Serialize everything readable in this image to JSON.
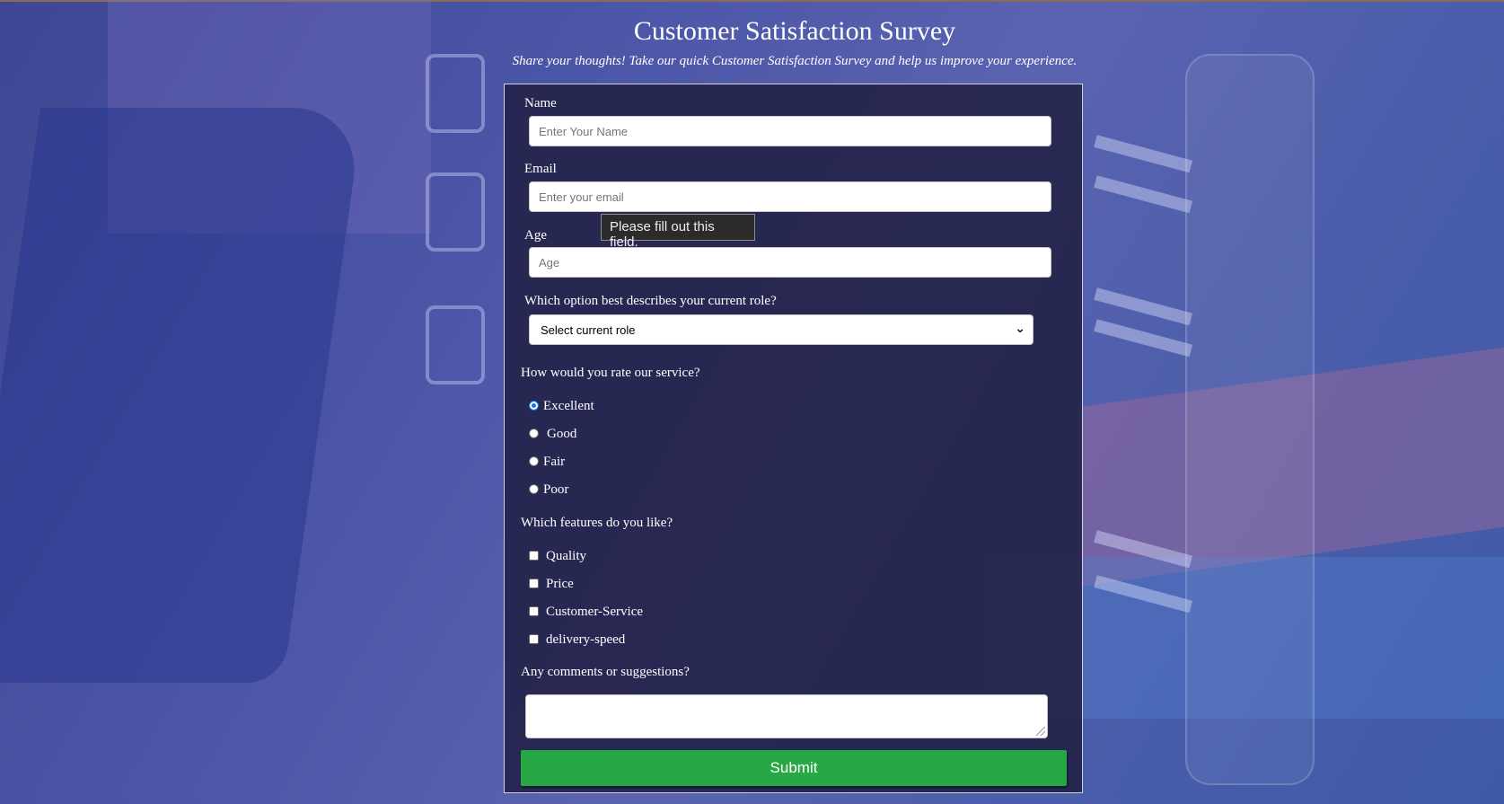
{
  "header": {
    "title": "Customer Satisfaction Survey",
    "subtitle": "Share your thoughts! Take our quick Customer Satisfaction Survey and help us improve your experience."
  },
  "form": {
    "name": {
      "label": "Name",
      "placeholder": "Enter Your Name",
      "value": ""
    },
    "email": {
      "label": "Email",
      "placeholder": "Enter your email",
      "value": ""
    },
    "validation_tooltip": "Please fill out this field.",
    "age": {
      "label": "Age",
      "placeholder": "Age",
      "value": ""
    },
    "role": {
      "label": "Which option best describes your current role?",
      "selected": "Select current role"
    },
    "rating": {
      "label": "How would you rate our service?",
      "options": [
        "Excellent",
        "Good",
        "Fair",
        "Poor"
      ],
      "selected": "Excellent"
    },
    "features": {
      "label": "Which features do you like?",
      "options": [
        "Quality",
        "Price",
        "Customer-Service",
        "delivery-speed"
      ],
      "checked": []
    },
    "comments": {
      "label": "Any comments or suggestions?",
      "value": ""
    },
    "submit_label": "Submit"
  },
  "colors": {
    "submit_bg": "#28a745",
    "card_bg": "#24244a",
    "page_bg": "#4b55a6"
  }
}
